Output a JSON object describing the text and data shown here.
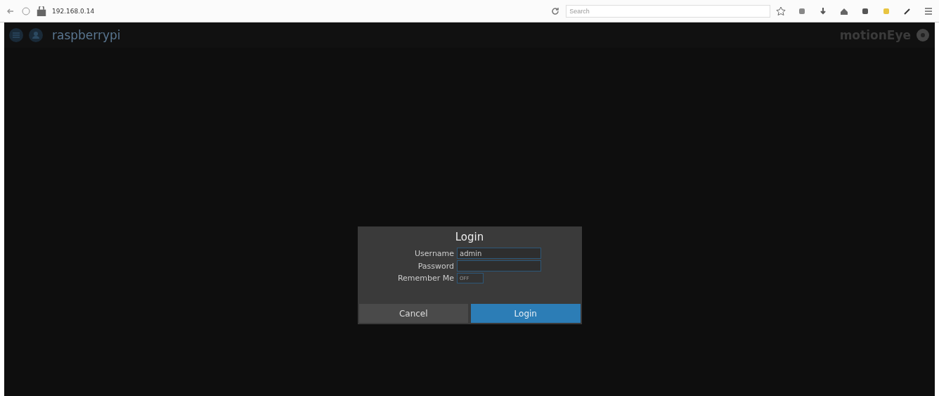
{
  "browser": {
    "url": "192.168.0.14",
    "search": {
      "placeholder": "Search"
    }
  },
  "header": {
    "title": "raspberrypi",
    "brand": "motionEye"
  },
  "dialog": {
    "title": "Login",
    "fields": [
      {
        "label": "Username",
        "value": "admin"
      },
      {
        "label": "Password"
      }
    ],
    "remember": {
      "label": "Remember Me",
      "on": false,
      "state_text": "OFF"
    },
    "buttons": [
      {
        "label": "Cancel",
        "kind": "secondary"
      },
      {
        "label": "Login",
        "kind": "primary"
      }
    ]
  }
}
